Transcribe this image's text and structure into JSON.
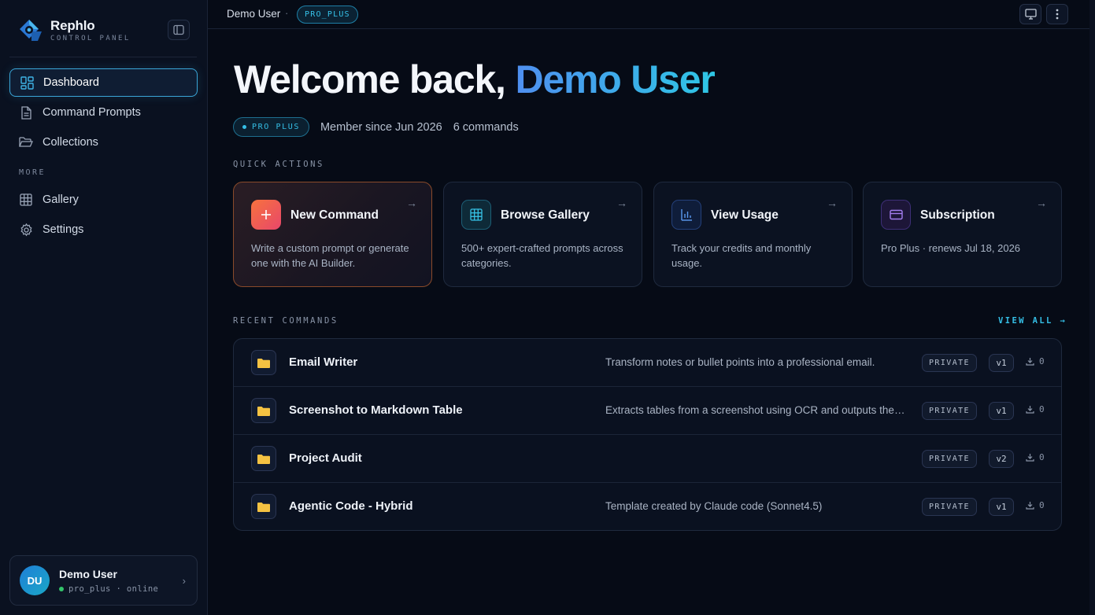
{
  "brand": {
    "name": "Rephlo",
    "subtitle": "CONTROL PANEL"
  },
  "sidebar": {
    "items": [
      {
        "label": "Dashboard",
        "icon": "dashboard-icon",
        "active": true
      },
      {
        "label": "Command Prompts",
        "icon": "document-icon",
        "active": false
      },
      {
        "label": "Collections",
        "icon": "folder-open-icon",
        "active": false
      }
    ],
    "more_label": "MORE",
    "more_items": [
      {
        "label": "Gallery",
        "icon": "grid-icon"
      },
      {
        "label": "Settings",
        "icon": "gear-icon"
      }
    ]
  },
  "user_card": {
    "initials": "DU",
    "name": "Demo User",
    "status": "pro_plus · online"
  },
  "topbar": {
    "user": "Demo User",
    "separator": "·",
    "plan_badge": "PRO_PLUS"
  },
  "welcome": {
    "prefix": "Welcome back,",
    "name": "Demo User",
    "plan_pill": "PRO PLUS",
    "member_since": "Member since Jun 2026",
    "commands_count": "6 commands"
  },
  "quick_actions": {
    "label": "QUICK ACTIONS",
    "cards": [
      {
        "title": "New Command",
        "description": "Write a custom prompt or generate one with the AI Builder.",
        "icon": "plus-icon"
      },
      {
        "title": "Browse Gallery",
        "description": "500+ expert-crafted prompts across categories.",
        "icon": "grid-icon"
      },
      {
        "title": "View Usage",
        "description": "Track your credits and monthly usage.",
        "icon": "bar-chart-icon"
      },
      {
        "title": "Subscription",
        "description": "Pro Plus · renews Jul 18, 2026",
        "icon": "credit-card-icon"
      }
    ]
  },
  "recent_commands": {
    "label": "RECENT COMMANDS",
    "view_all": "VIEW ALL",
    "rows": [
      {
        "name": "Email Writer",
        "description": "Transform notes or bullet points into a professional email.",
        "visibility": "PRIVATE",
        "version": "v1",
        "downloads": "0"
      },
      {
        "name": "Screenshot to Markdown Table",
        "description": "Extracts tables from a screenshot using OCR and outputs them as a Markdown table.",
        "visibility": "PRIVATE",
        "version": "v1",
        "downloads": "0"
      },
      {
        "name": "Project Audit",
        "description": "",
        "visibility": "PRIVATE",
        "version": "v2",
        "downloads": "0"
      },
      {
        "name": "Agentic Code - Hybrid",
        "description": "Template created by Claude code (Sonnet4.5)",
        "visibility": "PRIVATE",
        "version": "v1",
        "downloads": "0"
      }
    ]
  },
  "colors": {
    "accent": "#35bfe6",
    "background": "#060b16",
    "sidebar": "#0a1120",
    "orange": "#f06a3a",
    "folder": "#f5c242"
  }
}
